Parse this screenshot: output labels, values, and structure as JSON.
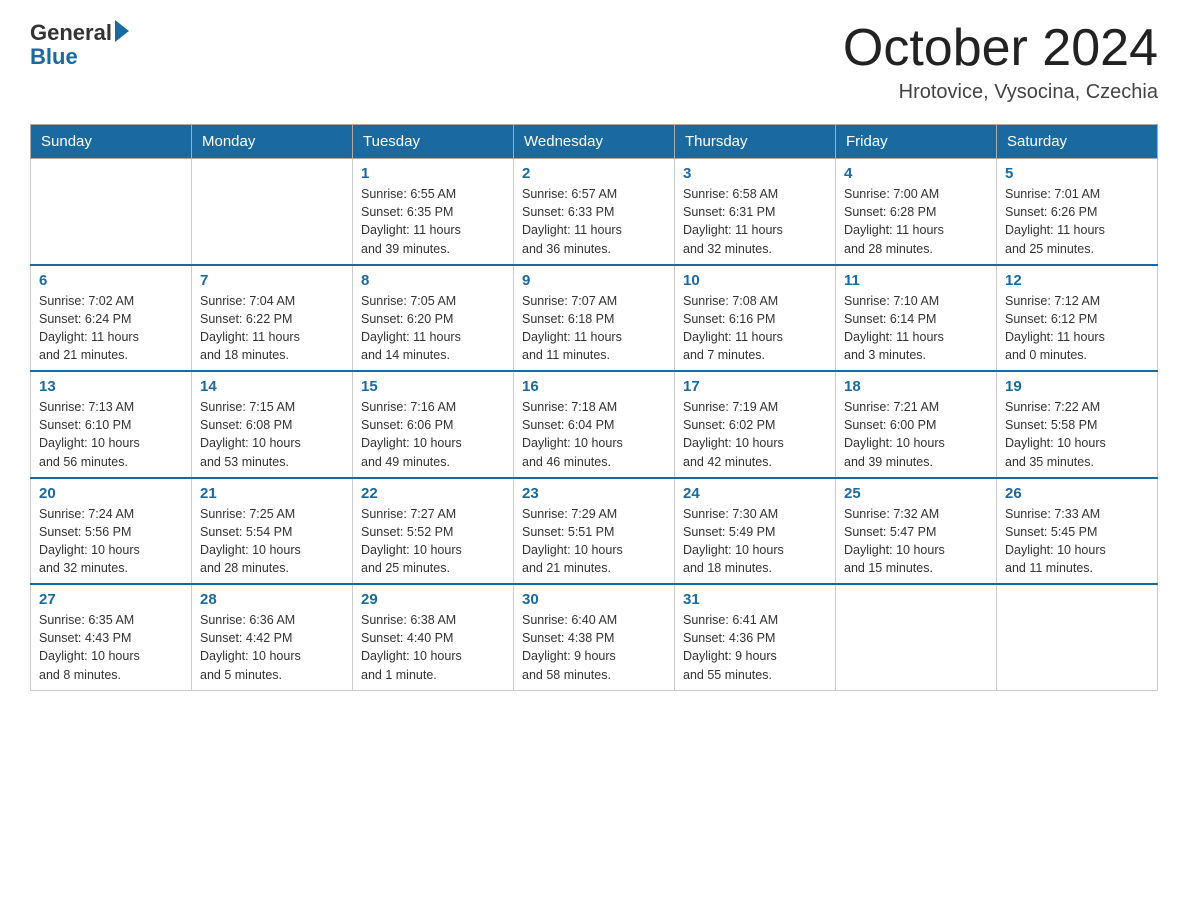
{
  "header": {
    "logo_general": "General",
    "logo_blue": "Blue",
    "month_title": "October 2024",
    "location": "Hrotovice, Vysocina, Czechia"
  },
  "calendar": {
    "days_of_week": [
      "Sunday",
      "Monday",
      "Tuesday",
      "Wednesday",
      "Thursday",
      "Friday",
      "Saturday"
    ],
    "weeks": [
      [
        {
          "day": "",
          "info": ""
        },
        {
          "day": "",
          "info": ""
        },
        {
          "day": "1",
          "info": "Sunrise: 6:55 AM\nSunset: 6:35 PM\nDaylight: 11 hours\nand 39 minutes."
        },
        {
          "day": "2",
          "info": "Sunrise: 6:57 AM\nSunset: 6:33 PM\nDaylight: 11 hours\nand 36 minutes."
        },
        {
          "day": "3",
          "info": "Sunrise: 6:58 AM\nSunset: 6:31 PM\nDaylight: 11 hours\nand 32 minutes."
        },
        {
          "day": "4",
          "info": "Sunrise: 7:00 AM\nSunset: 6:28 PM\nDaylight: 11 hours\nand 28 minutes."
        },
        {
          "day": "5",
          "info": "Sunrise: 7:01 AM\nSunset: 6:26 PM\nDaylight: 11 hours\nand 25 minutes."
        }
      ],
      [
        {
          "day": "6",
          "info": "Sunrise: 7:02 AM\nSunset: 6:24 PM\nDaylight: 11 hours\nand 21 minutes."
        },
        {
          "day": "7",
          "info": "Sunrise: 7:04 AM\nSunset: 6:22 PM\nDaylight: 11 hours\nand 18 minutes."
        },
        {
          "day": "8",
          "info": "Sunrise: 7:05 AM\nSunset: 6:20 PM\nDaylight: 11 hours\nand 14 minutes."
        },
        {
          "day": "9",
          "info": "Sunrise: 7:07 AM\nSunset: 6:18 PM\nDaylight: 11 hours\nand 11 minutes."
        },
        {
          "day": "10",
          "info": "Sunrise: 7:08 AM\nSunset: 6:16 PM\nDaylight: 11 hours\nand 7 minutes."
        },
        {
          "day": "11",
          "info": "Sunrise: 7:10 AM\nSunset: 6:14 PM\nDaylight: 11 hours\nand 3 minutes."
        },
        {
          "day": "12",
          "info": "Sunrise: 7:12 AM\nSunset: 6:12 PM\nDaylight: 11 hours\nand 0 minutes."
        }
      ],
      [
        {
          "day": "13",
          "info": "Sunrise: 7:13 AM\nSunset: 6:10 PM\nDaylight: 10 hours\nand 56 minutes."
        },
        {
          "day": "14",
          "info": "Sunrise: 7:15 AM\nSunset: 6:08 PM\nDaylight: 10 hours\nand 53 minutes."
        },
        {
          "day": "15",
          "info": "Sunrise: 7:16 AM\nSunset: 6:06 PM\nDaylight: 10 hours\nand 49 minutes."
        },
        {
          "day": "16",
          "info": "Sunrise: 7:18 AM\nSunset: 6:04 PM\nDaylight: 10 hours\nand 46 minutes."
        },
        {
          "day": "17",
          "info": "Sunrise: 7:19 AM\nSunset: 6:02 PM\nDaylight: 10 hours\nand 42 minutes."
        },
        {
          "day": "18",
          "info": "Sunrise: 7:21 AM\nSunset: 6:00 PM\nDaylight: 10 hours\nand 39 minutes."
        },
        {
          "day": "19",
          "info": "Sunrise: 7:22 AM\nSunset: 5:58 PM\nDaylight: 10 hours\nand 35 minutes."
        }
      ],
      [
        {
          "day": "20",
          "info": "Sunrise: 7:24 AM\nSunset: 5:56 PM\nDaylight: 10 hours\nand 32 minutes."
        },
        {
          "day": "21",
          "info": "Sunrise: 7:25 AM\nSunset: 5:54 PM\nDaylight: 10 hours\nand 28 minutes."
        },
        {
          "day": "22",
          "info": "Sunrise: 7:27 AM\nSunset: 5:52 PM\nDaylight: 10 hours\nand 25 minutes."
        },
        {
          "day": "23",
          "info": "Sunrise: 7:29 AM\nSunset: 5:51 PM\nDaylight: 10 hours\nand 21 minutes."
        },
        {
          "day": "24",
          "info": "Sunrise: 7:30 AM\nSunset: 5:49 PM\nDaylight: 10 hours\nand 18 minutes."
        },
        {
          "day": "25",
          "info": "Sunrise: 7:32 AM\nSunset: 5:47 PM\nDaylight: 10 hours\nand 15 minutes."
        },
        {
          "day": "26",
          "info": "Sunrise: 7:33 AM\nSunset: 5:45 PM\nDaylight: 10 hours\nand 11 minutes."
        }
      ],
      [
        {
          "day": "27",
          "info": "Sunrise: 6:35 AM\nSunset: 4:43 PM\nDaylight: 10 hours\nand 8 minutes."
        },
        {
          "day": "28",
          "info": "Sunrise: 6:36 AM\nSunset: 4:42 PM\nDaylight: 10 hours\nand 5 minutes."
        },
        {
          "day": "29",
          "info": "Sunrise: 6:38 AM\nSunset: 4:40 PM\nDaylight: 10 hours\nand 1 minute."
        },
        {
          "day": "30",
          "info": "Sunrise: 6:40 AM\nSunset: 4:38 PM\nDaylight: 9 hours\nand 58 minutes."
        },
        {
          "day": "31",
          "info": "Sunrise: 6:41 AM\nSunset: 4:36 PM\nDaylight: 9 hours\nand 55 minutes."
        },
        {
          "day": "",
          "info": ""
        },
        {
          "day": "",
          "info": ""
        }
      ]
    ]
  }
}
